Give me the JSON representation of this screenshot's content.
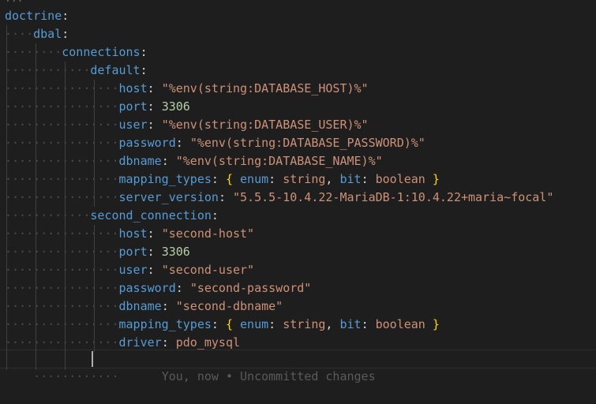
{
  "topmarker": "...",
  "lines": [
    {
      "indent": "",
      "key": "doctrine"
    },
    {
      "indent": "····",
      "key": "dbal"
    },
    {
      "indent": "········",
      "key": "connections"
    },
    {
      "indent": "············",
      "key": "default"
    },
    {
      "indent": "················",
      "key": "host",
      "value": "\"%env(string:DATABASE_HOST)%\"",
      "type": "str"
    },
    {
      "indent": "················",
      "key": "port",
      "value": "3306",
      "type": "num"
    },
    {
      "indent": "················",
      "key": "user",
      "value": "\"%env(string:DATABASE_USER)%\"",
      "type": "str"
    },
    {
      "indent": "················",
      "key": "password",
      "value": "\"%env(string:DATABASE_PASSWORD)%\"",
      "type": "str"
    },
    {
      "indent": "················",
      "key": "dbname",
      "value": "\"%env(string:DATABASE_NAME)%\"",
      "type": "str"
    },
    {
      "indent": "················",
      "key": "mapping_types",
      "type": "map",
      "map": {
        "k1": "enum",
        "v1": "string",
        "k2": "bit",
        "v2": "boolean"
      }
    },
    {
      "indent": "················",
      "key": "server_version",
      "value": "\"5.5.5-10.4.22-MariaDB-1:10.4.22+maria~focal\"",
      "type": "str"
    },
    {
      "indent": "············",
      "key": "second_connection"
    },
    {
      "indent": "················",
      "key": "host",
      "value": "\"second-host\"",
      "type": "str"
    },
    {
      "indent": "················",
      "key": "port",
      "value": "3306",
      "type": "num"
    },
    {
      "indent": "················",
      "key": "user",
      "value": "\"second-user\"",
      "type": "str"
    },
    {
      "indent": "················",
      "key": "password",
      "value": "\"second-password\"",
      "type": "str"
    },
    {
      "indent": "················",
      "key": "dbname",
      "value": "\"second-dbname\"",
      "type": "str"
    },
    {
      "indent": "················",
      "key": "mapping_types",
      "type": "map",
      "map": {
        "k1": "enum",
        "v1": "string",
        "k2": "bit",
        "v2": "boolean"
      }
    },
    {
      "indent": "················",
      "key": "driver",
      "value": "pdo_mysql",
      "type": "plain"
    }
  ],
  "cursor_line": {
    "indent": "············",
    "blame": "You, now • Uncommitted changes"
  },
  "colors": {
    "background": "#1e1e1e",
    "key": "#569cd6",
    "string": "#ce9178",
    "number": "#b5cea8",
    "brace": "#ffd700"
  }
}
